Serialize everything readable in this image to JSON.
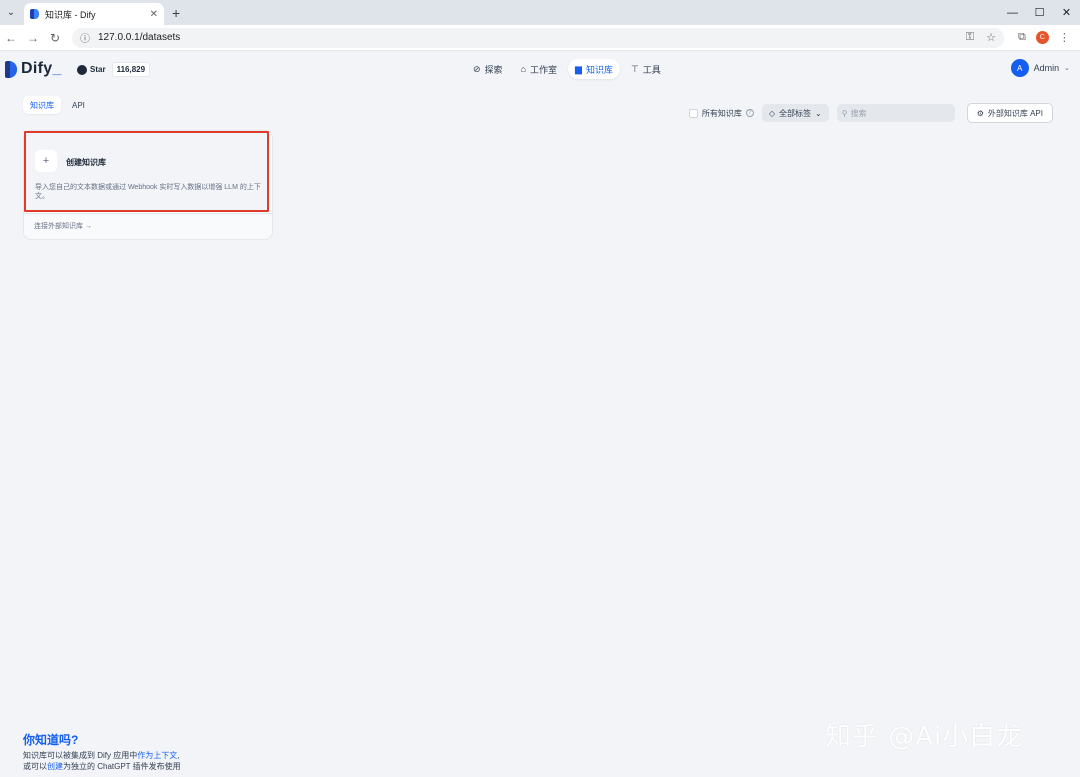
{
  "browser": {
    "tab_title": "知识库 - Dify",
    "url": "127.0.0.1/datasets"
  },
  "header": {
    "logo_text": "Dify",
    "github_label": "Star",
    "github_count": "116,829",
    "nav": [
      {
        "label": "探索",
        "icon": "compass-icon"
      },
      {
        "label": "工作室",
        "icon": "robot-icon"
      },
      {
        "label": "知识库",
        "icon": "book-icon",
        "active": true
      },
      {
        "label": "工具",
        "icon": "hammer-icon"
      }
    ],
    "user_initial": "A",
    "user_name": "Admin"
  },
  "subtabs": [
    {
      "label": "知识库",
      "active": true
    },
    {
      "label": "API",
      "active": false
    }
  ],
  "filters": {
    "all_datasets_label": "所有知识库",
    "tag_label": "全部标签",
    "search_placeholder": "搜索",
    "external_api_label": "外部知识库 API"
  },
  "create_card": {
    "plus": "+",
    "title": "创建知识库",
    "description": "导入您自己的文本数据或通过 Webhook 实时写入数据以增强 LLM 的上下文。",
    "external_link": "连接外部知识库 →"
  },
  "tip": {
    "title": "你知道吗?",
    "line1_pre": "知识库可以被集成到 Dify 应用中",
    "line1_link": "作为上下文",
    "line1_post": ",",
    "line2_pre": "或可以",
    "line2_link": "创建",
    "line2_post": "为独立的 ChatGPT 插件发布使用"
  },
  "watermark": "知乎 @Ai小白龙",
  "colors": {
    "accent": "#155eef",
    "highlight_border": "#e03a2c",
    "background": "#f2f4f7"
  }
}
